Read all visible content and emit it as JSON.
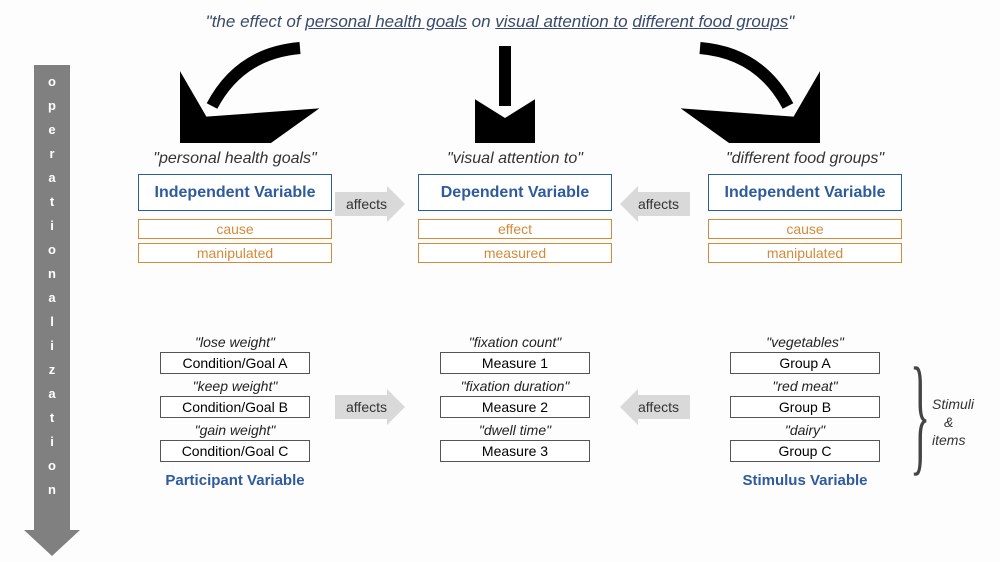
{
  "title": {
    "prefix": "\"the ",
    "word_effect": "effect",
    "of": " of ",
    "u1": "personal health goals",
    "mid": " on ",
    "u2": "visual attention to",
    "sp": " ",
    "u3": "different food groups",
    "suffix": "\""
  },
  "sidebar": "operationalization",
  "columns": {
    "left": {
      "header": "\"personal health goals\"",
      "var_type": "Independent Variable",
      "tags": [
        "cause",
        "manipulated"
      ],
      "items": [
        {
          "label": "\"lose weight\"",
          "box": "Condition/Goal A"
        },
        {
          "label": "\"keep weight\"",
          "box": "Condition/Goal B"
        },
        {
          "label": "\"gain weight\"",
          "box": "Condition/Goal C"
        }
      ],
      "bottom": "Participant Variable"
    },
    "mid": {
      "header": "\"visual attention to\"",
      "var_type": "Dependent Variable",
      "tags": [
        "effect",
        "measured"
      ],
      "items": [
        {
          "label": "\"fixation count\"",
          "box": "Measure 1"
        },
        {
          "label": "\"fixation duration\"",
          "box": "Measure 2"
        },
        {
          "label": "\"dwell time\"",
          "box": "Measure 3"
        }
      ]
    },
    "right": {
      "header": "\"different food groups\"",
      "var_type": "Independent Variable",
      "tags": [
        "cause",
        "manipulated"
      ],
      "items": [
        {
          "label": "\"vegetables\"",
          "box": "Group A"
        },
        {
          "label": "\"red meat\"",
          "box": "Group B"
        },
        {
          "label": "\"dairy\"",
          "box": "Group C"
        }
      ],
      "bottom": "Stimulus Variable"
    }
  },
  "relations": {
    "top_lr": "affects",
    "top_rl": "affects",
    "bot_lr": "affects",
    "bot_rl": "affects"
  },
  "bracket_label1": "Stimuli",
  "bracket_label2": "&",
  "bracket_label3": "items"
}
